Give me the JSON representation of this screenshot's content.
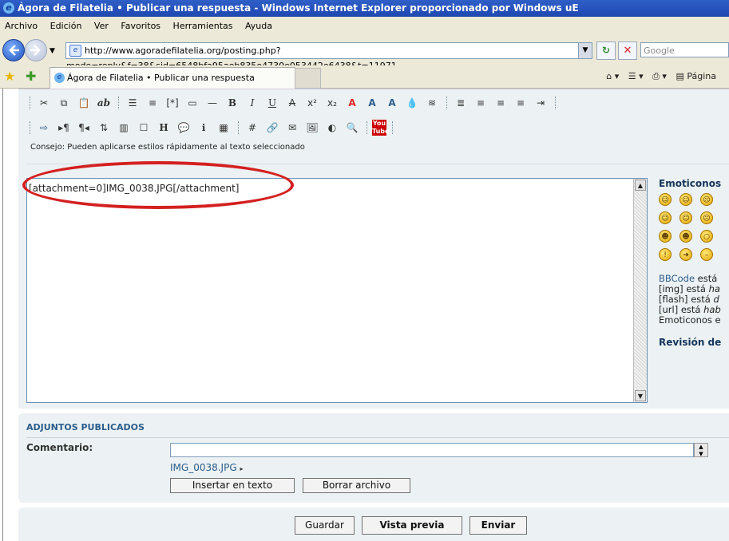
{
  "window": {
    "title": "Ágora de Filatelia • Publicar una respuesta - Windows Internet Explorer proporcionado por Windows uE"
  },
  "menu": [
    "Archivo",
    "Edición",
    "Ver",
    "Favoritos",
    "Herramientas",
    "Ayuda"
  ],
  "address": {
    "url": "http://www.agoradefilatelia.org/posting.php?mode=reply&f=38&sid=6548bfa95aeb835e4730e053442e6438&t=11971",
    "search_placeholder": "Google"
  },
  "tab": {
    "label": "Ágora de Filatelia • Publicar una respuesta"
  },
  "command_bar": {
    "page_label": "Página"
  },
  "editor": {
    "hint": "Consejo: Pueden aplicarse estilos rápidamente al texto seleccionado",
    "content": "[attachment=0]IMG_0038.JPG[/attachment]"
  },
  "emoticons": {
    "title": "Emoticonos",
    "bbcode_text": "BBCode",
    "bbcode_rest": " está",
    "img_line_prefix": "[img] está ",
    "img_line_em": "ha",
    "flash_line_prefix": "[flash] está ",
    "flash_line_em": "d",
    "url_line_prefix": "[url] está ",
    "url_line_em": "hab",
    "emo_line": "Emoticonos e",
    "review": "Revisión de"
  },
  "attachments": {
    "heading": "ADJUNTOS PUBLICADOS",
    "comment_label": "Comentario:",
    "file_name": "IMG_0038.JPG",
    "insert_label": "Insertar en texto",
    "delete_label": "Borrar archivo"
  },
  "actions": {
    "save": "Guardar",
    "preview": "Vista previa",
    "send": "Enviar"
  }
}
